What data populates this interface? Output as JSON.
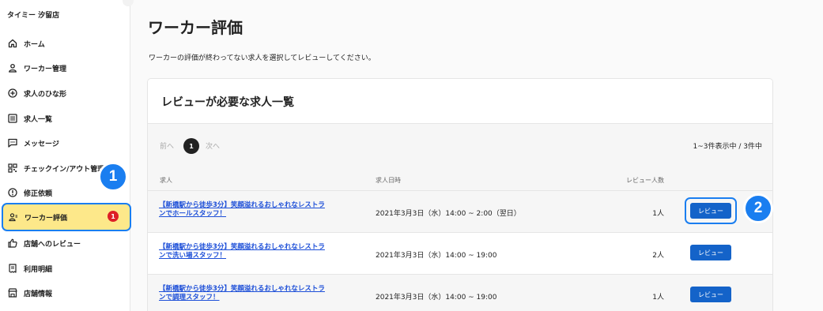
{
  "store": {
    "name": "タイミー 汐留店"
  },
  "sidebar": {
    "items": [
      {
        "label": "ホーム",
        "icon": "home-icon"
      },
      {
        "label": "ワーカー管理",
        "icon": "person-icon"
      },
      {
        "label": "求人のひな形",
        "icon": "add-circle-icon"
      },
      {
        "label": "求人一覧",
        "icon": "list-icon"
      },
      {
        "label": "メッセージ",
        "icon": "message-icon"
      },
      {
        "label": "チェックイン/アウト管理",
        "icon": "qr-code-icon"
      },
      {
        "label": "修正依頼",
        "icon": "alert-icon"
      },
      {
        "label": "ワーカー評価",
        "icon": "worker-review-icon",
        "badge": "1",
        "active": true
      },
      {
        "label": "店舗へのレビュー",
        "icon": "thumbs-up-icon"
      },
      {
        "label": "利用明細",
        "icon": "receipt-icon"
      },
      {
        "label": "店舗情報",
        "icon": "store-icon"
      }
    ]
  },
  "callouts": {
    "first": "1",
    "second": "2"
  },
  "main": {
    "title": "ワーカー評価",
    "description": "ワーカーの評価が終わってない求人を選択してレビューしてください。",
    "card": {
      "title": "レビューが必要な求人一覧",
      "pagination": {
        "prev": "前へ",
        "current": "1",
        "next": "次へ",
        "count": "1~3件表示中 / 3件中"
      },
      "columns": {
        "job": "求人",
        "date": "求人日時",
        "reviewers": "レビュー人数"
      },
      "rows": [
        {
          "job": "【新橋駅から徒歩3分】笑顔溢れるおしゃれなレストランでホールスタッフ！",
          "date": "2021年3月3日（水）14:00 ~ 2:00（翌日）",
          "count": "1人",
          "action": "レビュー"
        },
        {
          "job": "【新橋駅から徒歩3分】笑顔溢れるおしゃれなレストランで洗い場スタッフ！",
          "date": "2021年3月3日（水）14:00 ~ 19:00",
          "count": "2人",
          "action": "レビュー"
        },
        {
          "job": "【新橋駅から徒歩3分】笑顔溢れるおしゃれなレストランで調理スタッフ！",
          "date": "2021年3月3日（水）14:00 ~ 19:00",
          "count": "1人",
          "action": "レビュー"
        }
      ]
    }
  },
  "colors": {
    "accent": "#1a7ef0",
    "active_bg": "#fde88a",
    "badge": "#dd1f26",
    "button": "#1463c9",
    "link": "#1d4fd8"
  }
}
